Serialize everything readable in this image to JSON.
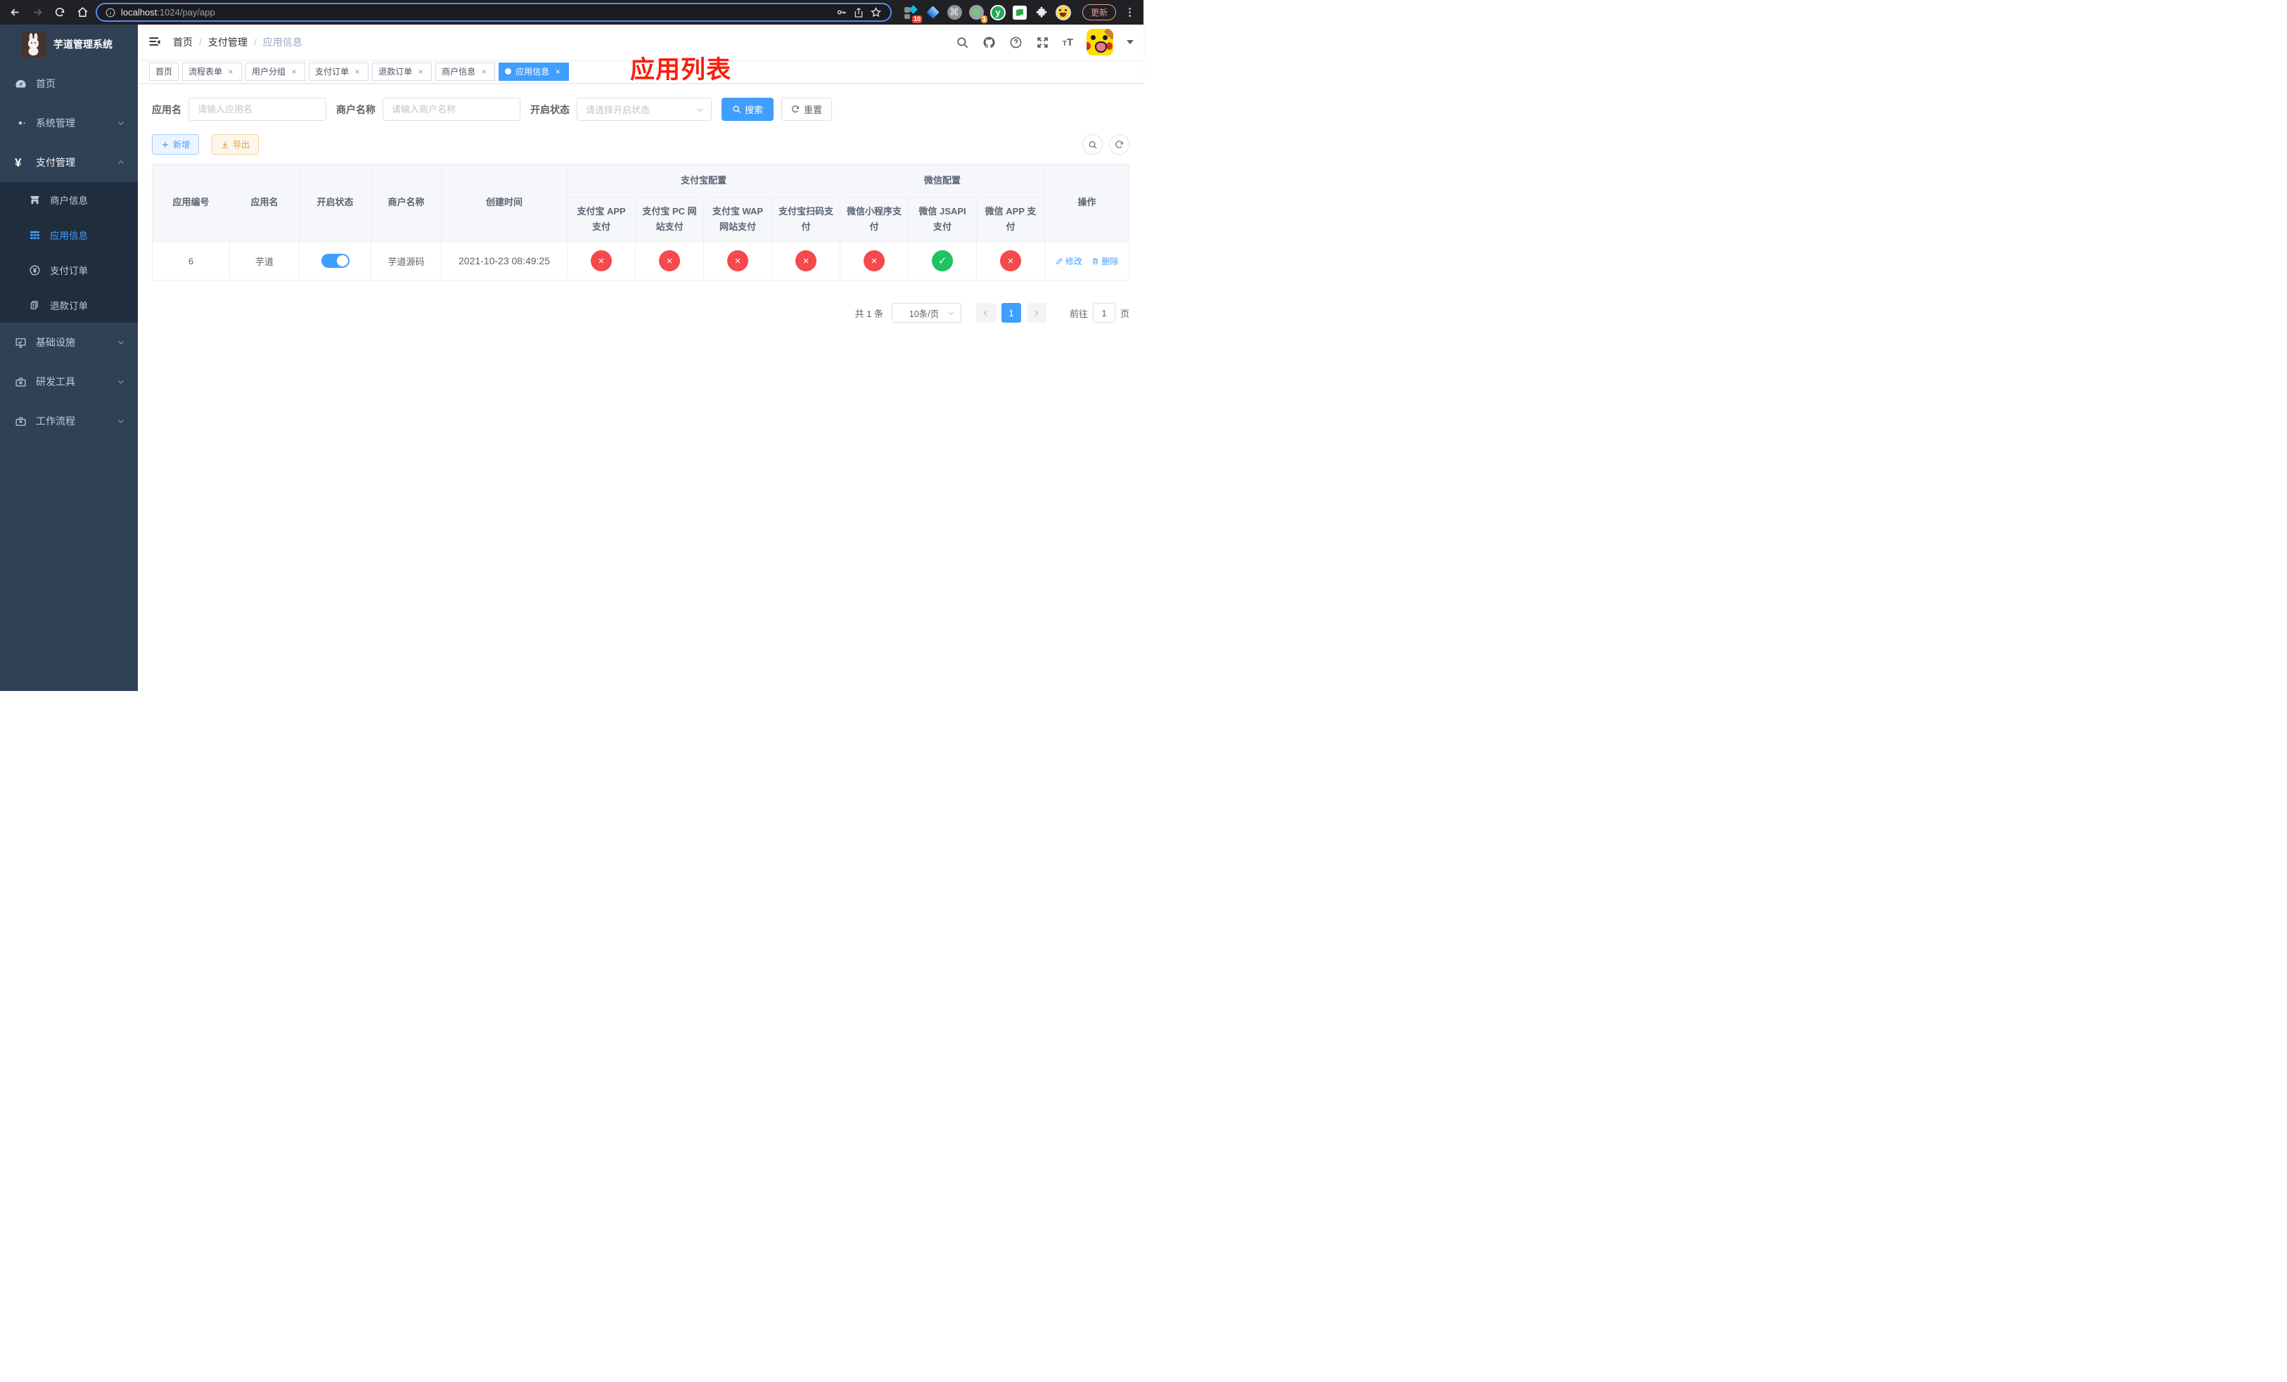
{
  "browser": {
    "url_host": "localhost",
    "url_rest": ":1024/pay/app",
    "update_button": "更新",
    "extension_badge_1": "10",
    "extension_badge_2": "1",
    "extension_y_label": "y"
  },
  "sidebar": {
    "title": "芋道管理系统",
    "items": [
      {
        "label": "首页"
      },
      {
        "label": "系统管理"
      },
      {
        "label": "支付管理"
      },
      {
        "label": "商户信息"
      },
      {
        "label": "应用信息"
      },
      {
        "label": "支付订单"
      },
      {
        "label": "退款订单"
      },
      {
        "label": "基础设施"
      },
      {
        "label": "研发工具"
      },
      {
        "label": "工作流程"
      }
    ]
  },
  "navbar": {
    "breadcrumb": [
      "首页",
      "支付管理",
      "应用信息"
    ],
    "annotation": "应用列表"
  },
  "tabs": [
    {
      "label": "首页"
    },
    {
      "label": "流程表单"
    },
    {
      "label": "用户分组"
    },
    {
      "label": "支付订单"
    },
    {
      "label": "退款订单"
    },
    {
      "label": "商户信息"
    },
    {
      "label": "应用信息"
    }
  ],
  "filters": {
    "app_name_label": "应用名",
    "app_name_placeholder": "请输入应用名",
    "merchant_label": "商户名称",
    "merchant_placeholder": "请输入商户名称",
    "status_label": "开启状态",
    "status_placeholder": "请选择开启状态",
    "search_button": "搜索",
    "reset_button": "重置"
  },
  "toolbar": {
    "add_button": "新增",
    "export_button": "导出"
  },
  "table": {
    "group_headers": {
      "alipay": "支付宝配置",
      "wechat": "微信配置"
    },
    "headers": [
      "应用编号",
      "应用名",
      "开启状态",
      "商户名称",
      "创建时间",
      "支付宝 APP 支付",
      "支付宝 PC 网站支付",
      "支付宝 WAP 网站支付",
      "支付宝扫码支付",
      "微信小程序支付",
      "微信 JSAPI 支付",
      "微信 APP 支付",
      "操作"
    ],
    "row": {
      "id": "6",
      "name": "芋道",
      "enabled": true,
      "merchant": "芋道源码",
      "created": "2021-10-23 08:49:25",
      "pay_statuses": [
        "no",
        "no",
        "no",
        "no",
        "no",
        "yes",
        "no"
      ],
      "edit_label": "修改",
      "delete_label": "删除"
    }
  },
  "pagination": {
    "total": "共 1 条",
    "page_size": "10条/页",
    "current_page": "1",
    "goto_label": "前往",
    "goto_value": "1",
    "page_label": "页"
  },
  "colors": {
    "accent": "#409eff",
    "success": "#1fc35f",
    "danger": "#f5494c",
    "warning": "#e6a23c",
    "sidebar_bg": "#304156",
    "submenu_bg": "#1f2d3d",
    "annotation_red": "#fb1d0c"
  }
}
